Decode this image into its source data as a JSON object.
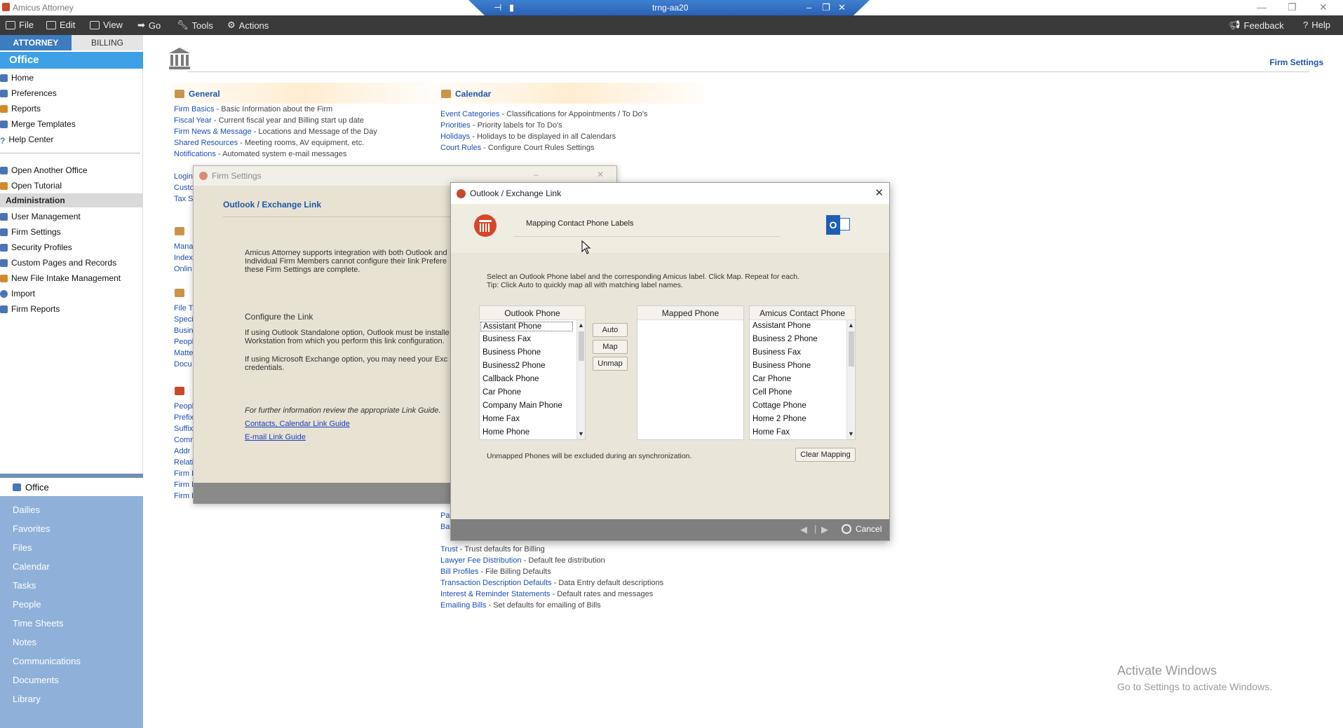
{
  "window": {
    "app_title": "Amicus Attorney",
    "remote_title": "trng-aa20"
  },
  "menubar": {
    "items": [
      "File",
      "Edit",
      "View",
      "Go",
      "Tools",
      "Actions"
    ],
    "feedback": "Feedback",
    "help": "Help"
  },
  "sidebar": {
    "tabs": [
      "ATTORNEY",
      "BILLING"
    ],
    "office_header": "Office",
    "top_links": [
      "Home",
      "Preferences",
      "Reports",
      "Merge Templates",
      "Help Center"
    ],
    "mid_links": [
      "Open Another Office",
      "Open Tutorial"
    ],
    "admin_header": "Administration",
    "admin_links": [
      "User Management",
      "Firm Settings",
      "Security Profiles",
      "Custom Pages and Records",
      "New File Intake Management",
      "Import",
      "Firm Reports"
    ],
    "nav_office": "Office",
    "nav_items": [
      "Dailies",
      "Favorites",
      "Files",
      "Calendar",
      "Tasks",
      "People",
      "Time Sheets",
      "Notes",
      "Communications",
      "Documents",
      "Library"
    ]
  },
  "main": {
    "firm_settings_link": "Firm Settings",
    "general": {
      "title": "General",
      "lines": [
        {
          "link": "Firm Basics",
          "desc": " - Basic Information about the Firm"
        },
        {
          "link": "Fiscal Year",
          "desc": " - Current fiscal year and Billing start up date"
        },
        {
          "link": "Firm News & Message",
          "desc": " - Locations and Message of the Day"
        },
        {
          "link": "Shared Resources",
          "desc": " - Meeting rooms, AV equipment, etc."
        },
        {
          "link": "Notifications",
          "desc": " - Automated system e-mail messages"
        }
      ]
    },
    "calendar": {
      "title": "Calendar",
      "lines": [
        {
          "link": "Event Categories",
          "desc": " - Classifications for Appointments / To Do's"
        },
        {
          "link": "Priorities",
          "desc": " - Priority labels for To Do's"
        },
        {
          "link": "Holidays",
          "desc": " - Holidays to be displayed in all Calendars"
        },
        {
          "link": "Court Rules",
          "desc": " - Configure Court Rules Settings"
        }
      ]
    },
    "billing_lines": [
      {
        "link": "Trust",
        "desc": " - Trust defaults for Billing"
      },
      {
        "link": "Lawyer Fee Distribution",
        "desc": " - Default fee distribution"
      },
      {
        "link": "Bill Profiles",
        "desc": " - File Billing Defaults"
      },
      {
        "link": "Transaction Description Defaults",
        "desc": " - Data Entry default descriptions"
      },
      {
        "link": "Interest & Reminder Statements",
        "desc": " - Default rates and messages"
      },
      {
        "link": "Emailing Bills",
        "desc": " - Set defaults for emailing of Bills"
      }
    ],
    "partial_left_links": [
      "Login",
      "Custo",
      "Tax S",
      "Mana",
      "Index",
      "Onlin",
      "File T",
      "Speci",
      "Busin",
      "Peopl",
      "Matte",
      "Docu",
      "Peopl",
      "Prefix",
      "Suffix",
      "Comm",
      "Addr",
      "Relati",
      "Firm I",
      "Firm I",
      "Firm I"
    ],
    "partial_right_links": [
      "Pa",
      "Ba"
    ]
  },
  "firm_settings_dialog": {
    "title": "Firm Settings",
    "heading": "Outlook / Exchange Link",
    "para1": [
      "Amicus Attorney supports integration with both Outlook and",
      "Individual Firm Members cannot configure their link Prefere",
      "these Firm Settings are complete."
    ],
    "configure": "Configure the Link",
    "para2": [
      "If using Outlook Standalone option, Outlook must be installe",
      "Workstation from which you perform this link configuration."
    ],
    "para3": [
      "If using Microsoft Exchange option, you may need your Exc",
      "credentials."
    ],
    "further": "For further information review the appropriate Link Guide.",
    "link1": "Contacts, Calendar Link Guide",
    "link2": "E-mail Link Guide"
  },
  "outlook_dialog": {
    "title": "Outlook / Exchange Link",
    "subtitle": "Mapping Contact Phone Labels",
    "instructions1": "Select an Outlook Phone label and the corresponding Amicus label. Click Map. Repeat for each.",
    "instructions2": "Tip: Click Auto to quickly map all with matching label names.",
    "outlook_header": "Outlook Phone",
    "outlook_phones": [
      "Assistant Phone",
      "Business Fax",
      "Business Phone",
      "Business2 Phone",
      "Callback Phone",
      "Car Phone",
      "Company Main Phone",
      "Home Fax",
      "Home Phone"
    ],
    "mapped_header": "Mapped Phone",
    "amicus_header": "Amicus Contact Phone",
    "amicus_phones": [
      "Assistant Phone",
      "Business 2 Phone",
      "Business Fax",
      "Business Phone",
      "Car Phone",
      "Cell Phone",
      "Cottage Phone",
      "Home 2 Phone",
      "Home Fax"
    ],
    "btn_auto": "Auto",
    "btn_map": "Map",
    "btn_unmap": "Unmap",
    "btn_clear": "Clear Mapping",
    "note": "Unmapped Phones will be excluded during an synchronization.",
    "cancel": "Cancel",
    "outlook_badge": "O"
  },
  "watermark": {
    "line1": "Activate Windows",
    "line2": "Go to Settings to activate Windows."
  }
}
